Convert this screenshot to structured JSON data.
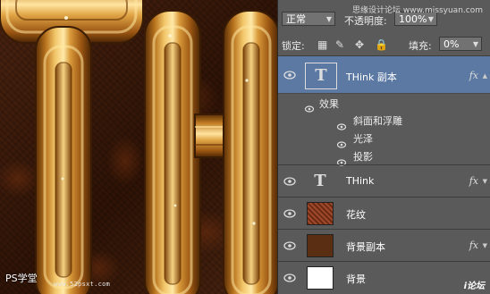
{
  "canvas": {
    "letters": [
      "T",
      "H"
    ],
    "watermark": "PS学堂",
    "watermark_url": "www.52psxt.com",
    "colors": {
      "background": "#3a1a08",
      "gold_dark": "#6b3a08",
      "gold_mid": "#c8842a",
      "gold_light": "#ffe9a8"
    }
  },
  "site_watermark": "思缘设计论坛  www.missyuan.com",
  "panel": {
    "blend_mode": "正常",
    "opacity_label": "不透明度:",
    "opacity_value": "100%",
    "lock_label": "锁定:",
    "fill_label": "填充:",
    "fill_value": "0%",
    "layers": [
      {
        "name": "THink 副本",
        "type": "text",
        "fx": "fx",
        "selected": true
      },
      {
        "name": "THink",
        "type": "text",
        "fx": "fx",
        "selected": false
      },
      {
        "name": "花纹",
        "type": "pattern",
        "fx": "",
        "selected": false
      },
      {
        "name": "背景副本",
        "type": "brown",
        "fx": "fx",
        "selected": false
      },
      {
        "name": "背景",
        "type": "white",
        "fx": "",
        "selected": false
      }
    ],
    "effects_label": "效果",
    "effects": [
      "斜面和浮雕",
      "光泽",
      "投影"
    ],
    "thumb_glyph": "T",
    "bottom_watermark": "i论坛"
  }
}
